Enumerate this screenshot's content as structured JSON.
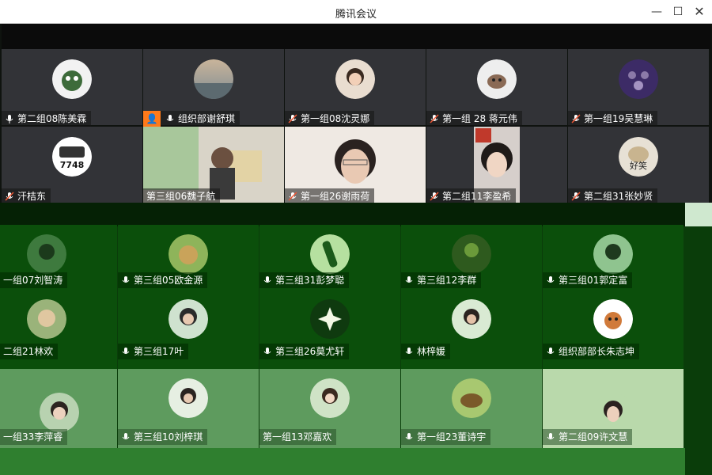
{
  "window": {
    "title": "腾讯会议"
  },
  "icons": {
    "minimize": "minimize-icon",
    "maximize": "maximize-icon",
    "close": "close-icon",
    "mic": "mic-icon",
    "host": "host-icon"
  },
  "colors": {
    "tile_dark": "#323337",
    "host_badge": "#ff7a1a",
    "green_overlay": "#0a3d0a"
  },
  "row1": [
    {
      "name": "第二组08陈美霖"
    },
    {
      "name": "组织部谢舒琪",
      "host": true
    },
    {
      "name": "第一组08沈灵娜"
    },
    {
      "name": "第一组 28 蒋元伟"
    },
    {
      "name": "第一组19吴慧琳"
    }
  ],
  "row2": [
    {
      "name": "汗桔东",
      "avatar_text": "7748"
    },
    {
      "name": "第三组06魏子航"
    },
    {
      "name": "第一组26谢雨荷"
    },
    {
      "name": "第二组11李盈希"
    },
    {
      "name": "第二组31张妙贤",
      "avatar_text": "好笑"
    }
  ],
  "grow1": [
    {
      "name": "一组07刘智涛"
    },
    {
      "name": "第三组05欧金源"
    },
    {
      "name": "第三组31彭梦聪"
    },
    {
      "name": "第三组12李群"
    },
    {
      "name": "第三组01郭定富"
    }
  ],
  "grow2": [
    {
      "name": "二组21林欢"
    },
    {
      "name": "第三组17叶"
    },
    {
      "name": "第三组26莫尤轩"
    },
    {
      "name": "林梓媛"
    },
    {
      "name": "组织部部长朱志坤"
    }
  ],
  "grow3": [
    {
      "name": "一组33李萍睿"
    },
    {
      "name": "第三组10刘梓琪"
    },
    {
      "name": "第一组13邓嘉欢"
    },
    {
      "name": "第一组23董诗宇"
    },
    {
      "name": "第二组09许文慧"
    }
  ]
}
